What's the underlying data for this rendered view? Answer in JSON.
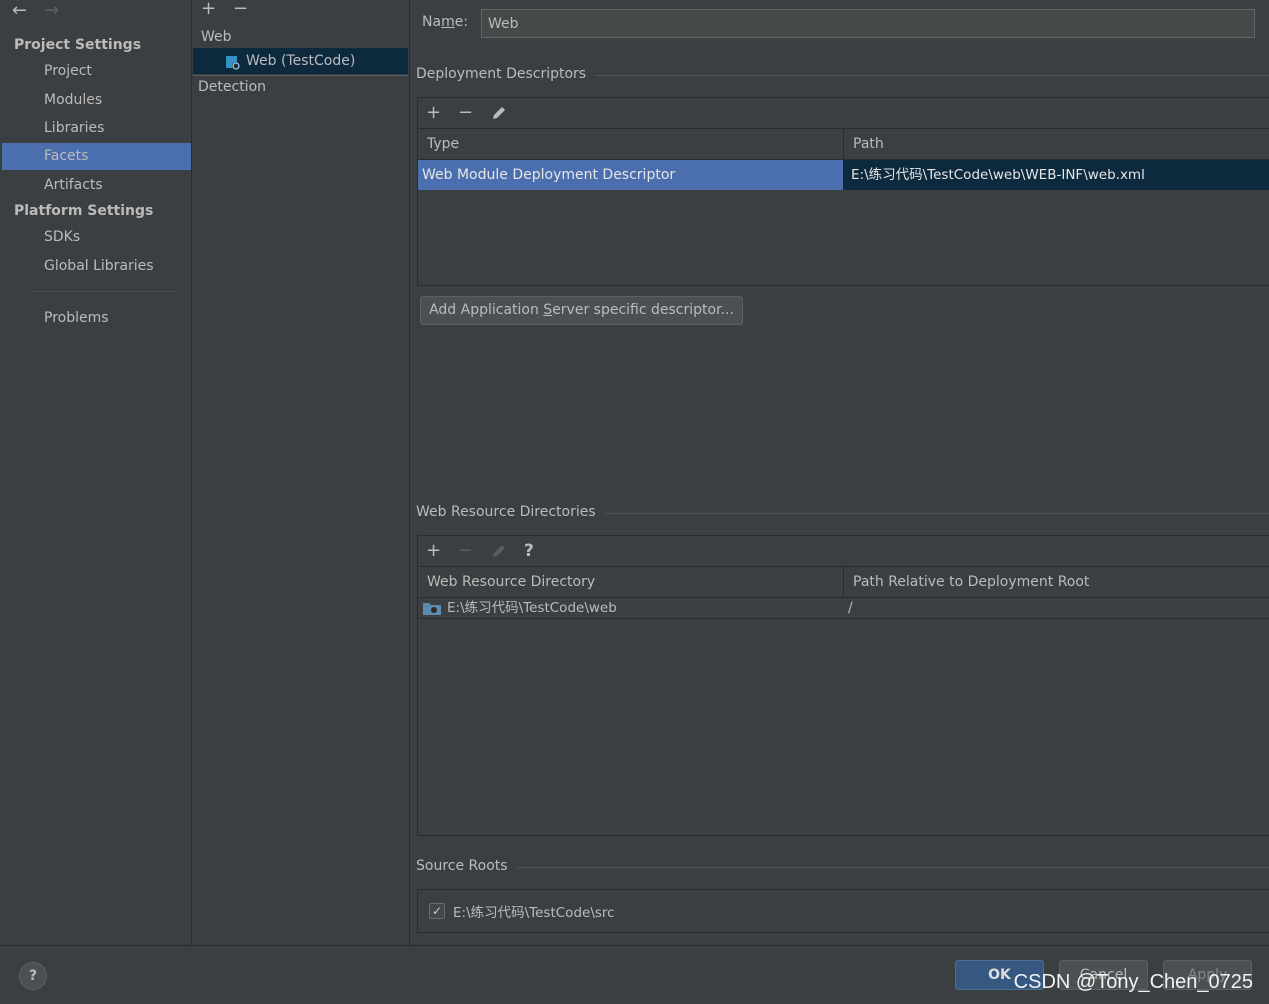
{
  "nav": {
    "back_icon": "←",
    "forward_icon": "→"
  },
  "sidebar": {
    "project_settings_title": "Project Settings",
    "project_items": [
      "Project",
      "Modules",
      "Libraries",
      "Facets",
      "Artifacts"
    ],
    "platform_settings_title": "Platform Settings",
    "platform_items": [
      "SDKs",
      "Global Libraries"
    ],
    "problems": "Problems",
    "selected": "Facets"
  },
  "tree": {
    "add_icon": "+",
    "remove_icon": "−",
    "group": "Web",
    "facet": "Web (TestCode)",
    "detection": "Detection"
  },
  "name_field": {
    "label_pre": "Na",
    "label_mnemonic": "m",
    "label_post": "e:",
    "value": "Web"
  },
  "deployment": {
    "title": "Deployment Descriptors",
    "columns": [
      "Type",
      "Path"
    ],
    "rows": [
      {
        "type": "Web Module Deployment Descriptor",
        "path": "E:\\练习代码\\TestCode\\web\\WEB-INF\\web.xml"
      }
    ],
    "add_server_button_pre": "Add Application ",
    "add_server_button_mnemonic": "S",
    "add_server_button_post": "erver specific descriptor..."
  },
  "web_resources": {
    "title": "Web Resource Directories",
    "help_icon": "?",
    "columns": [
      "Web Resource Directory",
      "Path Relative to Deployment Root"
    ],
    "rows": [
      {
        "directory": "E:\\练习代码\\TestCode\\web",
        "relative": "/"
      }
    ]
  },
  "source_roots": {
    "title": "Source Roots",
    "items": [
      {
        "checked": true,
        "path": "E:\\练习代码\\TestCode\\src"
      }
    ]
  },
  "footer": {
    "help": "?",
    "ok": "OK",
    "cancel": "Cancel",
    "apply": "Apply",
    "watermark": "CSDN @Tony_Chen_0725"
  },
  "colors": {
    "selection": "#4b6eaf",
    "row_selection_dark": "#0d293e",
    "background": "#3c3f41"
  }
}
